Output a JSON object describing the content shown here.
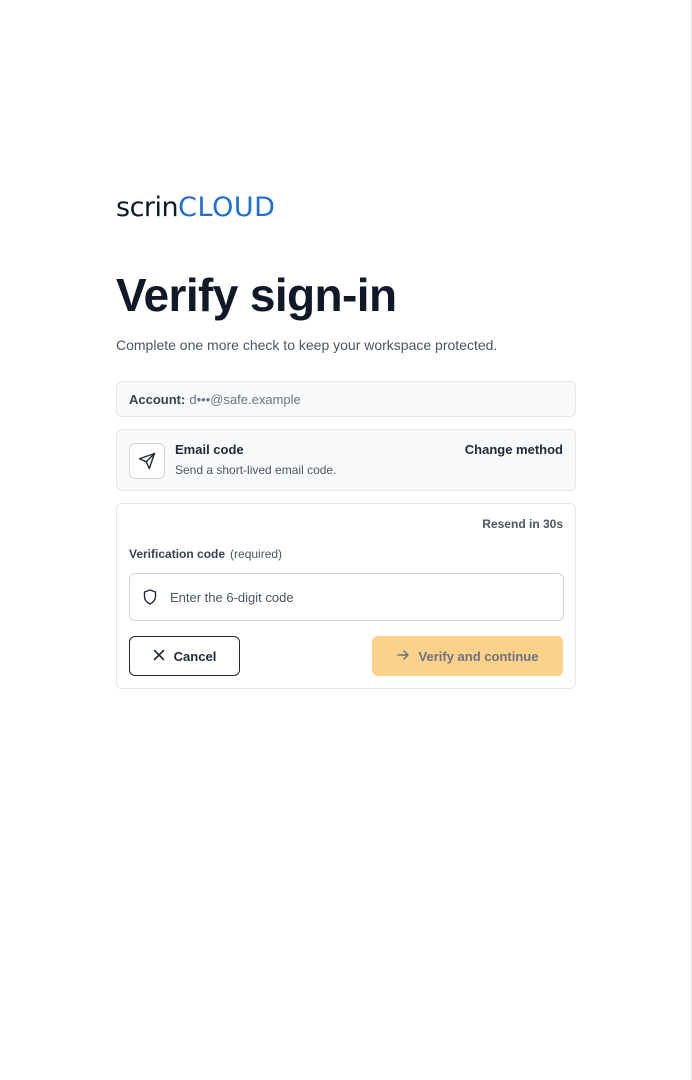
{
  "brand": {
    "logo_left": "scrin",
    "logo_right": "CLOUD",
    "brand_color": "#1d6fd6",
    "accent_color": "#f5a524"
  },
  "page": {
    "title": "Verify sign-in",
    "subtitle": "Complete one more check to keep your workspace protected."
  },
  "account": {
    "label": "Account:",
    "value": "d•••@safe.example"
  },
  "method": {
    "icon": "send-icon",
    "title": "Email code",
    "description": "Send a short-lived email code.",
    "change_label": "Change method"
  },
  "verification": {
    "resend_label": "Resend in 30s",
    "field_label": "Verification code",
    "required_label": "(required)",
    "placeholder": "Enter the 6-digit code",
    "value": "",
    "input_icon": "shield-icon"
  },
  "actions": {
    "cancel_label": "Cancel",
    "cancel_icon": "close-icon",
    "verify_label": "Verify and continue",
    "verify_icon": "arrow-right-icon",
    "verify_color": "#fcd18a"
  }
}
